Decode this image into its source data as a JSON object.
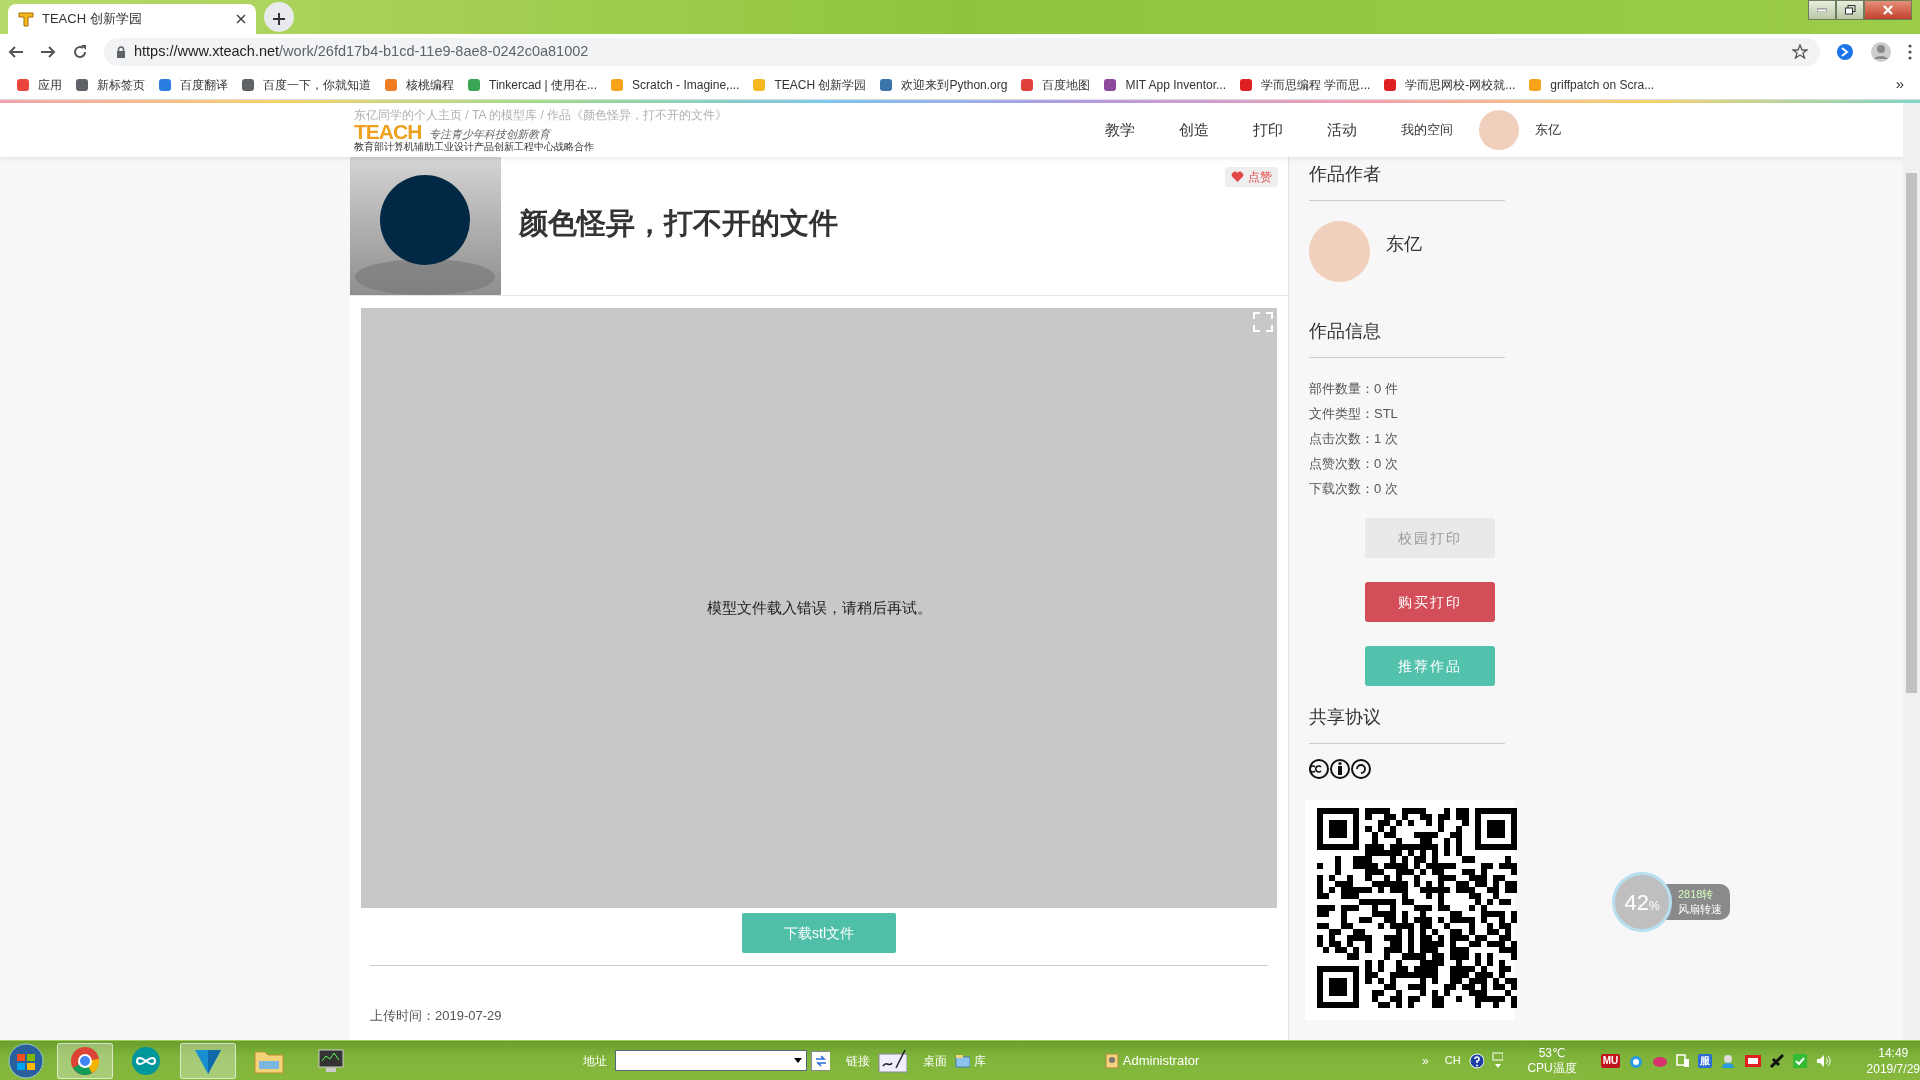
{
  "browser": {
    "tab_title": "TEACH 创新学园",
    "url_host": "https://www.xteach.net",
    "url_path": "/work/26fd17b4-b1cd-11e9-8ae8-0242c0a81002",
    "bookmarks": [
      {
        "label": "应用",
        "color": "#e8453c"
      },
      {
        "label": "新标签页",
        "color": "#5f6368"
      },
      {
        "label": "百度翻译",
        "color": "#2a7de1"
      },
      {
        "label": "百度一下，你就知道",
        "color": "#5f6368"
      },
      {
        "label": "核桃编程",
        "color": "#f07c22"
      },
      {
        "label": "Tinkercad | 使用在...",
        "color": "#3aa655"
      },
      {
        "label": "Scratch - Imagine,...",
        "color": "#f7a21b"
      },
      {
        "label": "TEACH 创新学园",
        "color": "#f5b820"
      },
      {
        "label": "欢迎来到Python.org",
        "color": "#3b74a8"
      },
      {
        "label": "百度地图",
        "color": "#e0403a"
      },
      {
        "label": "MIT App Inventor...",
        "color": "#8c4a9c"
      },
      {
        "label": "学而思编程 学而思...",
        "color": "#e02020"
      },
      {
        "label": "学而思网校-网校就...",
        "color": "#e02020"
      },
      {
        "label": "griffpatch on Scra...",
        "color": "#f7a21b"
      }
    ],
    "overflow": "»"
  },
  "site": {
    "breadcrumb": "东亿同学的个人主页 / TA 的模型库 / 作品《颜色怪异，打不开的文件》",
    "logo": "TEACH",
    "slogan": "专注青少年科技创新教育",
    "partner": "教育部计算机辅助工业设计产品创新工程中心战略合作",
    "nav": [
      "教学",
      "创造",
      "打印",
      "活动",
      "我的空间"
    ],
    "user": "东亿"
  },
  "work": {
    "title": "颜色怪异，打不开的文件",
    "like": "点赞",
    "viewer_message": "模型文件载入错误，请稍后再试。",
    "download": "下载stl文件",
    "upload_time": "上传时间：2019-07-29"
  },
  "sidebar": {
    "author_heading": "作品作者",
    "author": "东亿",
    "info_heading": "作品信息",
    "info": [
      "部件数量：0 件",
      "文件类型：STL",
      "点击次数：1 次",
      "点赞次数：0 次",
      "下载次数：0 次"
    ],
    "buttons": [
      {
        "label": "校园打印",
        "kind": "muted"
      },
      {
        "label": "购买打印",
        "kind": "red"
      },
      {
        "label": "推荐作品",
        "kind": "teal"
      }
    ],
    "license_heading": "共享协议"
  },
  "fan_widget": {
    "percent": "42",
    "unit": "%",
    "speed": "2818转",
    "label": "风扇转速"
  },
  "taskbar": {
    "address_label": "地址",
    "links_label": "链接",
    "desktop_label": "桌面",
    "library_label": "库",
    "user": "Administrator",
    "overflow": "»",
    "lang": "CH",
    "tray_badges": [
      "MU",
      "服"
    ],
    "temp": "53℃",
    "temp_label": "CPU温度",
    "time": "14:49",
    "date": "2019/7/29"
  }
}
